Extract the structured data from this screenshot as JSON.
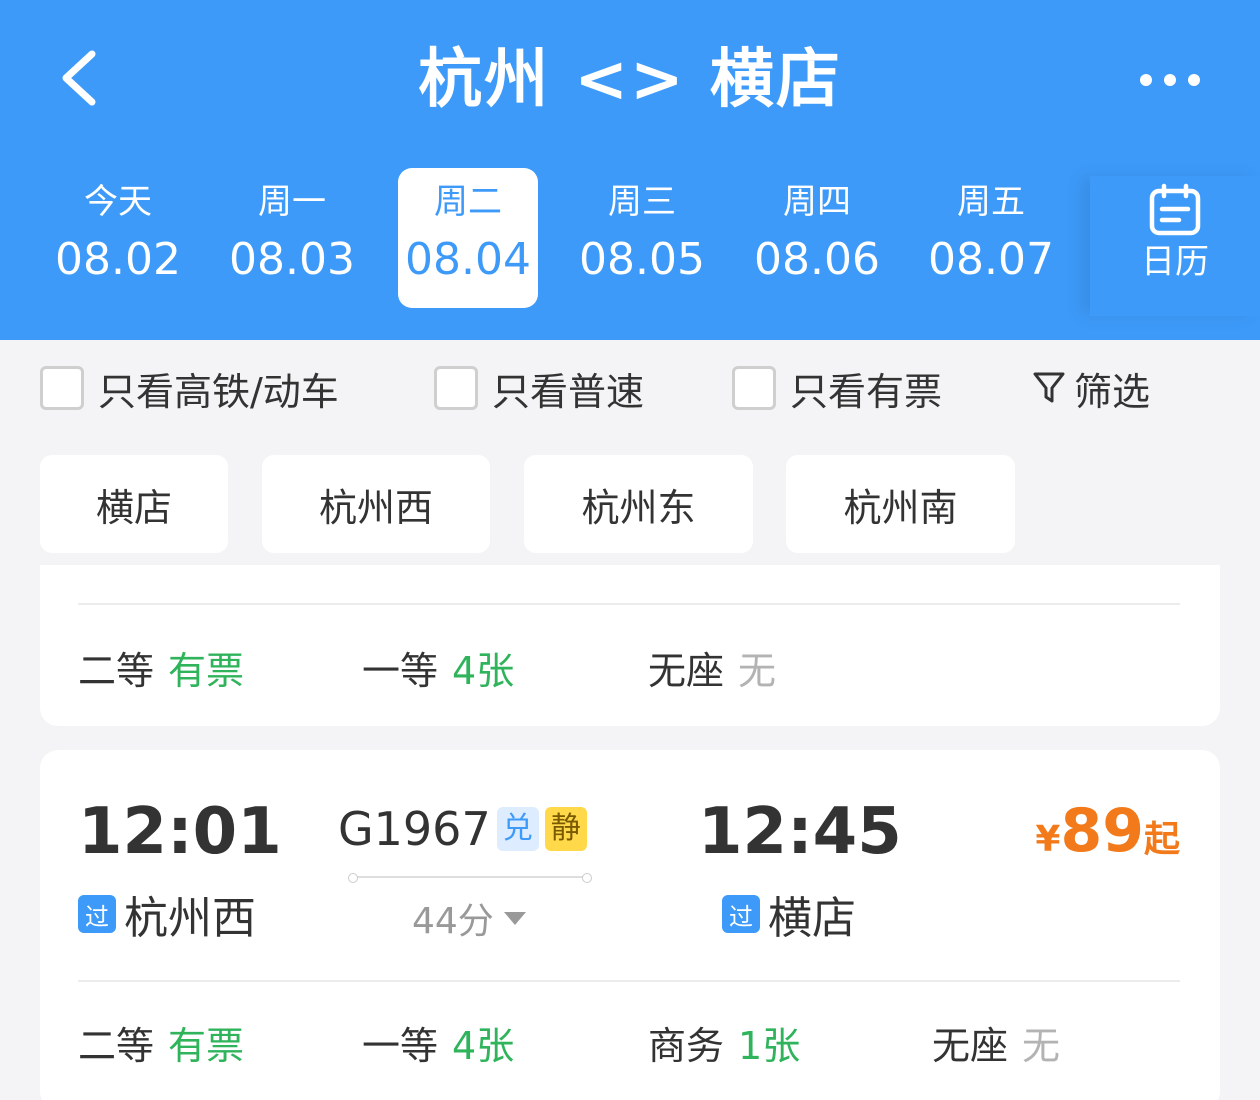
{
  "header": {
    "title": "杭州 <> 横店",
    "back_icon": "chevron-left-icon",
    "more_icon": "more-dots-icon",
    "background_color": "#3d9af9"
  },
  "date_tabs": [
    {
      "weekday": "今天",
      "date": "08.02",
      "selected": false
    },
    {
      "weekday": "周一",
      "date": "08.03",
      "selected": false
    },
    {
      "weekday": "周二",
      "date": "08.04",
      "selected": true
    },
    {
      "weekday": "周三",
      "date": "08.05",
      "selected": false
    },
    {
      "weekday": "周四",
      "date": "08.06",
      "selected": false
    },
    {
      "weekday": "周五",
      "date": "08.07",
      "selected": false
    }
  ],
  "calendar": {
    "label": "日历",
    "icon": "calendar-icon"
  },
  "filters": {
    "high_speed_label": "只看高铁/动车",
    "regular_label": "只看普速",
    "available_label": "只看有票",
    "filter_label": "筛选",
    "filter_icon": "funnel-icon"
  },
  "stations": [
    "横店",
    "杭州西",
    "杭州东",
    "杭州南"
  ],
  "trains": [
    {
      "seats": [
        {
          "class": "二等",
          "status": "有票",
          "available": true
        },
        {
          "class": "一等",
          "status": "4张",
          "available": true
        },
        {
          "class": "无座",
          "status": "无",
          "available": false
        }
      ]
    },
    {
      "depart_time": "12:01",
      "depart_station": "杭州西",
      "depart_badge": "过",
      "train_no": "G1967",
      "tags": [
        "兑",
        "静"
      ],
      "duration": "44分",
      "arrive_time": "12:45",
      "arrive_station": "横店",
      "arrive_badge": "过",
      "price_currency": "¥",
      "price": "89",
      "price_suffix": "起",
      "seats": [
        {
          "class": "二等",
          "status": "有票",
          "available": true
        },
        {
          "class": "一等",
          "status": "4张",
          "available": true
        },
        {
          "class": "商务",
          "status": "1张",
          "available": true
        },
        {
          "class": "无座",
          "status": "无",
          "available": false
        }
      ]
    }
  ],
  "colors": {
    "accent": "#3d9af9",
    "available": "#2fb35b",
    "unavailable": "#b3b3b3",
    "price": "#f27a1a"
  }
}
